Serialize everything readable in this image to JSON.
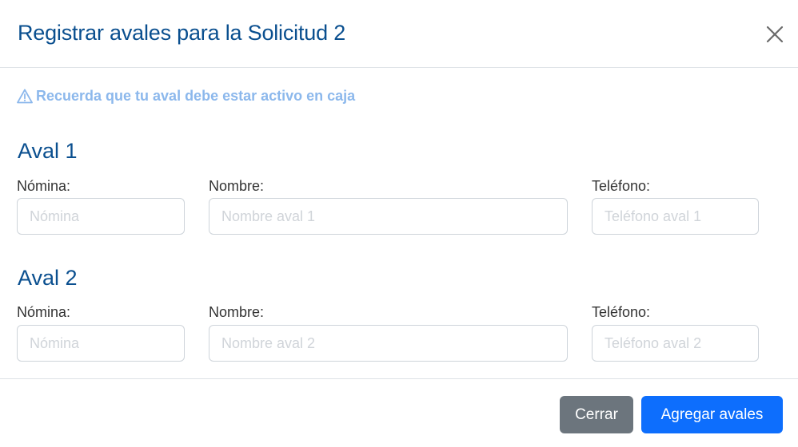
{
  "modal": {
    "title": "Registrar avales para la Solicitud 2",
    "close_icon": "close-icon"
  },
  "warning": {
    "icon": "warning-triangle-icon",
    "text": "Recuerda que tu aval debe estar activo en caja",
    "color": "#8cb8ec"
  },
  "avales": [
    {
      "title": "Aval 1",
      "nomina_label": "Nómina:",
      "nomina_placeholder": "Nómina",
      "nomina_value": "",
      "nombre_label": "Nombre:",
      "nombre_placeholder": "Nombre aval 1",
      "nombre_value": "",
      "telefono_label": "Teléfono:",
      "telefono_placeholder": "Teléfono aval 1",
      "telefono_value": ""
    },
    {
      "title": "Aval 2",
      "nomina_label": "Nómina:",
      "nomina_placeholder": "Nómina",
      "nomina_value": "",
      "nombre_label": "Nombre:",
      "nombre_placeholder": "Nombre aval 2",
      "nombre_value": "",
      "telefono_label": "Teléfono:",
      "telefono_placeholder": "Teléfono aval 2",
      "telefono_value": ""
    }
  ],
  "footer": {
    "cancel_label": "Cerrar",
    "submit_label": "Agregar avales"
  },
  "colors": {
    "title": "#0a4f8f",
    "primary": "#0d6efd",
    "secondary": "#6c757d",
    "border": "#ced4da"
  }
}
